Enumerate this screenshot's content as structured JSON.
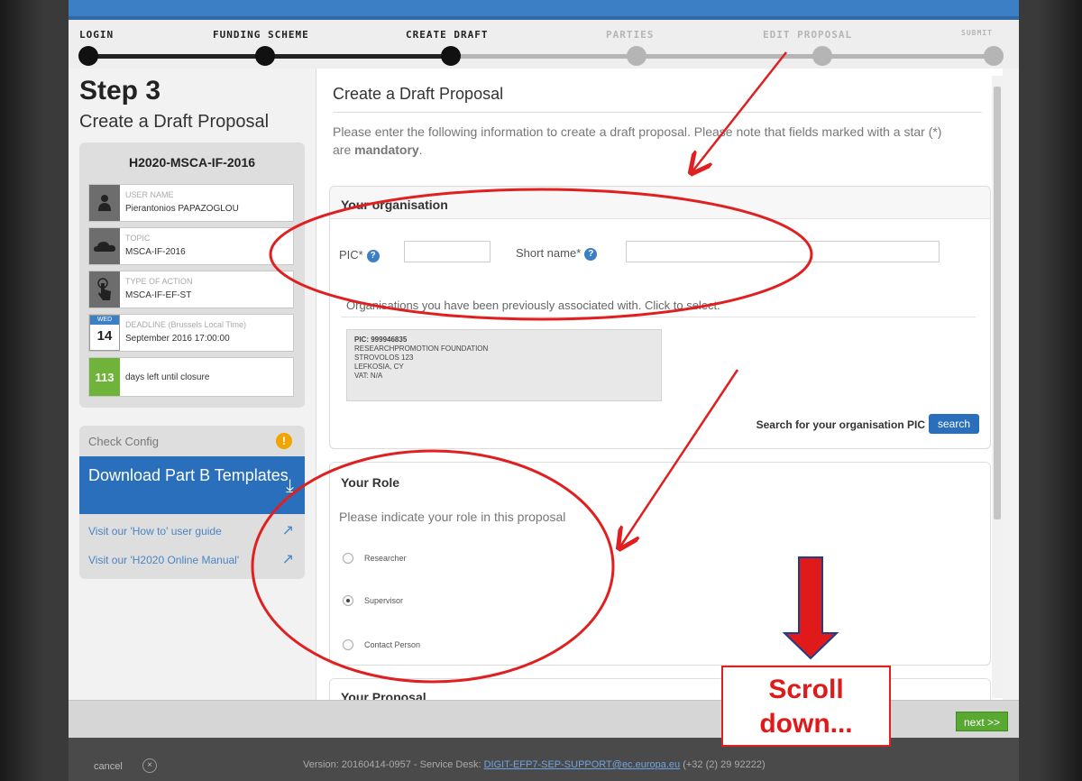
{
  "wizard": {
    "steps": [
      {
        "label": "LOGIN",
        "state": "done"
      },
      {
        "label": "FUNDING SCHEME",
        "state": "done"
      },
      {
        "label": "CREATE DRAFT",
        "state": "current"
      },
      {
        "label": "PARTIES",
        "state": "todo"
      },
      {
        "label": "EDIT PROPOSAL",
        "state": "todo"
      },
      {
        "label": "SUBMIT",
        "state": "todo"
      }
    ]
  },
  "left": {
    "step_title": "Step 3",
    "step_subtitle": "Create a Draft Proposal",
    "call_id": "H2020-MSCA-IF-2016",
    "user_caption": "USER NAME",
    "user_value": "Pierantonios PAPAZOGLOU",
    "topic_caption": "TOPIC",
    "topic_value": "MSCA-IF-2016",
    "action_caption": "TYPE OF ACTION",
    "action_value": "MSCA-IF-EF-ST",
    "deadline_caption": "DEADLINE (Brussels Local Time)",
    "deadline_value": "September 2016 17:00:00",
    "deadline_weekday": "WED",
    "deadline_day": "14",
    "days_left": "113",
    "days_left_label": "days left until closure",
    "check_config": "Check Config",
    "check_warn": "!",
    "download_label": "Download Part B Templates",
    "link_guide": "Visit our 'How to' user guide",
    "link_manual": "Visit our 'H2020 Online Manual'"
  },
  "main": {
    "title": "Create a Draft Proposal",
    "intro_text": "Please enter the following information to create a draft proposal. Please note that fields marked with a star (*) are ",
    "intro_bold": "mandatory",
    "intro_end": ".",
    "org_panel": {
      "heading": "Your organisation",
      "pic_label": "PIC*",
      "short_name_label": "Short name*",
      "help": "?",
      "prev_text": "Organisations you have been previously associated with. Click to select.",
      "card_lines": [
        "PIC: 999946835",
        "RESEARCHPROMOTION FOUNDATION",
        "STROVOLOS 123",
        "LEFKOSIA, CY",
        "VAT: N/A"
      ],
      "search_label": "Search for your organisation PIC",
      "search_button": "search"
    },
    "role_panel": {
      "heading": "Your Role",
      "prompt": "Please indicate your role in this proposal",
      "options": [
        {
          "label": "Researcher",
          "checked": false
        },
        {
          "label": "Supervisor",
          "checked": true
        },
        {
          "label": "Contact Person",
          "checked": false
        }
      ]
    },
    "proposal_panel": {
      "heading": "Your Proposal"
    }
  },
  "footer": {
    "next_label": "next >>",
    "cancel_label": "cancel",
    "cancel_icon": "×",
    "version_text": "Version: 20160414-0957 - Service Desk: ",
    "service_email": "DIGIT-EFP7-SEP-SUPPORT@ec.europa.eu",
    "service_phone": " (+32 (2) 29 92222)"
  },
  "annotation": {
    "scroll_line1": "Scroll",
    "scroll_line2": "down...",
    "color": "#e01a1a"
  }
}
